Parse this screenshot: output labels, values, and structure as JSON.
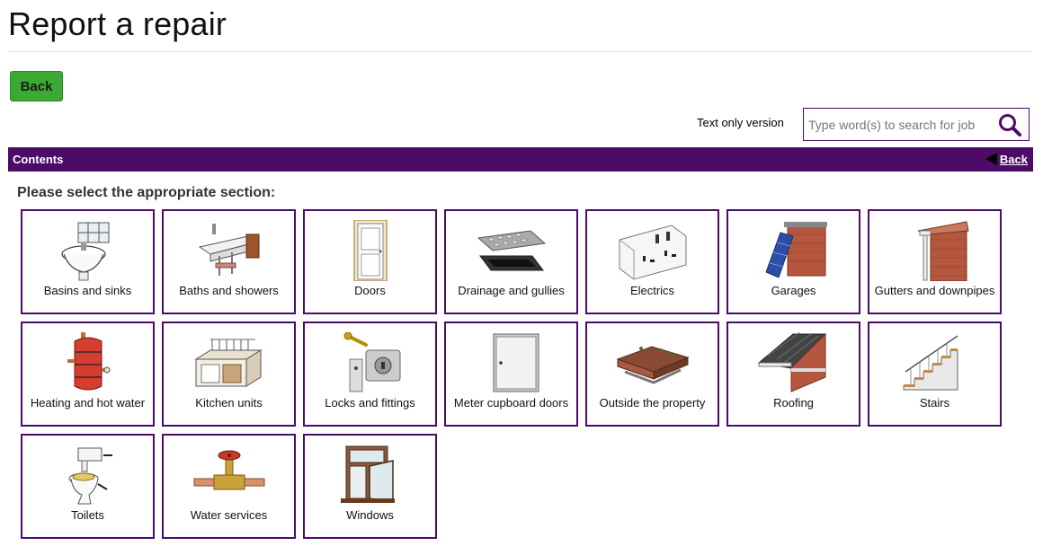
{
  "page": {
    "title": "Report a repair"
  },
  "toolbar": {
    "back_label": "Back",
    "text_only_label": "Text only version"
  },
  "search": {
    "placeholder": "Type word(s) to search for job",
    "value": ""
  },
  "contents_bar": {
    "label": "Contents",
    "back_label": "Back"
  },
  "instruction": "Please select the appropriate section:",
  "sections": [
    {
      "label": "Basins and sinks",
      "icon": "basin-icon"
    },
    {
      "label": "Baths and showers",
      "icon": "bath-icon"
    },
    {
      "label": "Doors",
      "icon": "door-icon"
    },
    {
      "label": "Drainage and gullies",
      "icon": "drain-icon"
    },
    {
      "label": "Electrics",
      "icon": "socket-icon"
    },
    {
      "label": "Garages",
      "icon": "garage-icon"
    },
    {
      "label": "Gutters and downpipes",
      "icon": "gutter-icon"
    },
    {
      "label": "Heating and hot water",
      "icon": "cylinder-icon"
    },
    {
      "label": "Kitchen units",
      "icon": "kitchen-icon"
    },
    {
      "label": "Locks and fittings",
      "icon": "lock-icon"
    },
    {
      "label": "Meter cupboard doors",
      "icon": "meter-cupboard-icon"
    },
    {
      "label": "Outside the property",
      "icon": "wall-icon"
    },
    {
      "label": "Roofing",
      "icon": "roof-icon"
    },
    {
      "label": "Stairs",
      "icon": "stairs-icon"
    },
    {
      "label": "Toilets",
      "icon": "toilet-icon"
    },
    {
      "label": "Water services",
      "icon": "valve-icon"
    },
    {
      "label": "Windows",
      "icon": "window-icon"
    }
  ],
  "colors": {
    "brand_purple": "#4b0b67",
    "back_button_green": "#3aaa35"
  }
}
